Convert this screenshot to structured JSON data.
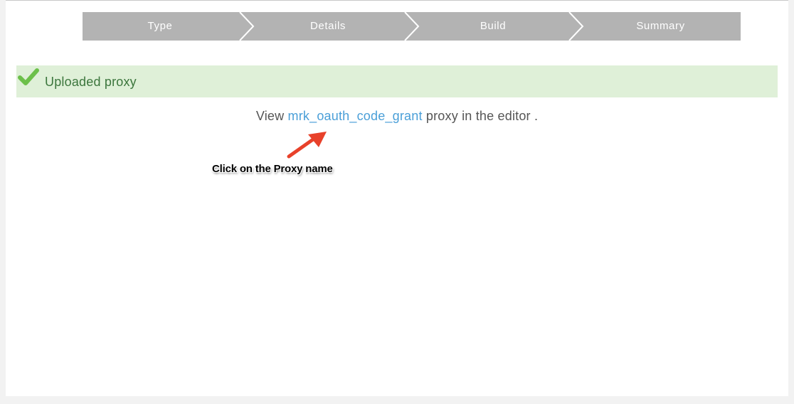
{
  "wizard": {
    "steps": [
      {
        "label": "Type"
      },
      {
        "label": "Details"
      },
      {
        "label": "Build"
      },
      {
        "label": "Summary"
      }
    ]
  },
  "alert": {
    "icon": "checkmark-icon",
    "text": "Uploaded proxy"
  },
  "result": {
    "prefix": "View",
    "proxy_name": "mrk_oauth_code_grant",
    "suffix": "proxy in the editor ."
  },
  "annotation": {
    "text": "Click on the Proxy name",
    "arrow_icon": "red-arrow-icon"
  },
  "colors": {
    "wizard_bg": "#b3b3b3",
    "alert_bg": "#dff0d8",
    "alert_text": "#3c763d",
    "check": "#6cc04a",
    "link": "#4a9fd8",
    "arrow": "#e8412a"
  }
}
